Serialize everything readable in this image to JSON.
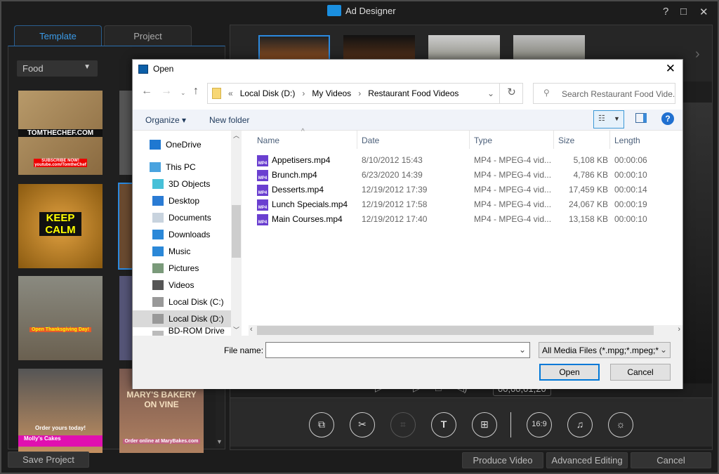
{
  "app": {
    "title": "Ad Designer",
    "help_icon": "?",
    "maximize_icon": "□",
    "close_icon": "✕"
  },
  "tabs": [
    {
      "label": "Template",
      "active": true
    },
    {
      "label": "Project",
      "active": false
    }
  ],
  "category": {
    "selected": "Food"
  },
  "templates": [
    {
      "text": "TOMTHECHEF.COM",
      "sub": "SUBSCRIBE NOW! youtube.com/TomtheChef"
    },
    {
      "text": "KEEP CALM"
    },
    {
      "text": "Open Thanksgiving Day!"
    },
    {
      "text": "Order yours today!",
      "sub": "Molly's Cakes"
    },
    {
      "text": "MARY'S BAKERY ON VINE",
      "sub": "Order online at MaryBakes.com"
    }
  ],
  "player": {
    "timecode": "00;00;01;20"
  },
  "tools": [
    {
      "name": "replace-media",
      "glyph": "⧉"
    },
    {
      "name": "trim",
      "glyph": "✂"
    },
    {
      "name": "crop",
      "glyph": "⌗",
      "disabled": true
    },
    {
      "name": "text",
      "glyph": "T"
    },
    {
      "name": "add-media",
      "glyph": "⊞"
    },
    {
      "name": "aspect-ratio",
      "glyph": "16:9"
    },
    {
      "name": "music",
      "glyph": "♫"
    },
    {
      "name": "brightness",
      "glyph": "☼"
    }
  ],
  "footer": {
    "save_project": "Save Project",
    "produce_video": "Produce Video",
    "advanced_editing": "Advanced Editing",
    "cancel": "Cancel"
  },
  "dialog": {
    "title": "Open",
    "breadcrumb": {
      "prefix": "«",
      "parts": [
        "Local Disk (D:)",
        "My Videos",
        "Restaurant Food Videos"
      ]
    },
    "search_placeholder": "Search Restaurant Food Vide...",
    "organize": "Organize ▾",
    "new_folder": "New folder",
    "nav": [
      {
        "label": "OneDrive",
        "icon": "onedrive-icon",
        "color": "#1f78d1"
      },
      {
        "label": "This PC",
        "icon": "pc-icon",
        "color": "#4aa3df"
      },
      {
        "label": "3D Objects",
        "icon": "cube-icon",
        "color": "#47c0d8"
      },
      {
        "label": "Desktop",
        "icon": "desktop-icon",
        "color": "#2a7bd4"
      },
      {
        "label": "Documents",
        "icon": "document-icon",
        "color": "#c8d3de"
      },
      {
        "label": "Downloads",
        "icon": "download-icon",
        "color": "#2b88d8"
      },
      {
        "label": "Music",
        "icon": "music-icon",
        "color": "#2b88d8"
      },
      {
        "label": "Pictures",
        "icon": "pictures-icon",
        "color": "#7a9a7a"
      },
      {
        "label": "Videos",
        "icon": "videos-icon",
        "color": "#555"
      },
      {
        "label": "Local Disk (C:)",
        "icon": "drive-icon",
        "color": "#999"
      },
      {
        "label": "Local Disk (D:)",
        "icon": "drive-icon",
        "color": "#999",
        "selected": true
      },
      {
        "label": "BD-ROM Drive (I",
        "icon": "disc-icon",
        "color": "#bbb"
      }
    ],
    "columns": [
      "Name",
      "Date",
      "Type",
      "Size",
      "Length"
    ],
    "files": [
      {
        "name": "Appetisers.mp4",
        "date": "8/10/2012 15:43",
        "type": "MP4 - MPEG-4 vid...",
        "size": "5,108 KB",
        "length": "00:00:06"
      },
      {
        "name": "Brunch.mp4",
        "date": "6/23/2020 14:39",
        "type": "MP4 - MPEG-4 vid...",
        "size": "4,786 KB",
        "length": "00:00:10"
      },
      {
        "name": "Desserts.mp4",
        "date": "12/19/2012 17:39",
        "type": "MP4 - MPEG-4 vid...",
        "size": "17,459 KB",
        "length": "00:00:14"
      },
      {
        "name": "Lunch Specials.mp4",
        "date": "12/19/2012 17:58",
        "type": "MP4 - MPEG-4 vid...",
        "size": "24,067 KB",
        "length": "00:00:19"
      },
      {
        "name": "Main Courses.mp4",
        "date": "12/19/2012 17:40",
        "type": "MP4 - MPEG-4 vid...",
        "size": "13,158 KB",
        "length": "00:00:10"
      }
    ],
    "file_name_label": "File name:",
    "file_name_value": "",
    "filter": "All Media Files (*.mpg;*.mpeg;*",
    "open": "Open",
    "cancel": "Cancel"
  }
}
